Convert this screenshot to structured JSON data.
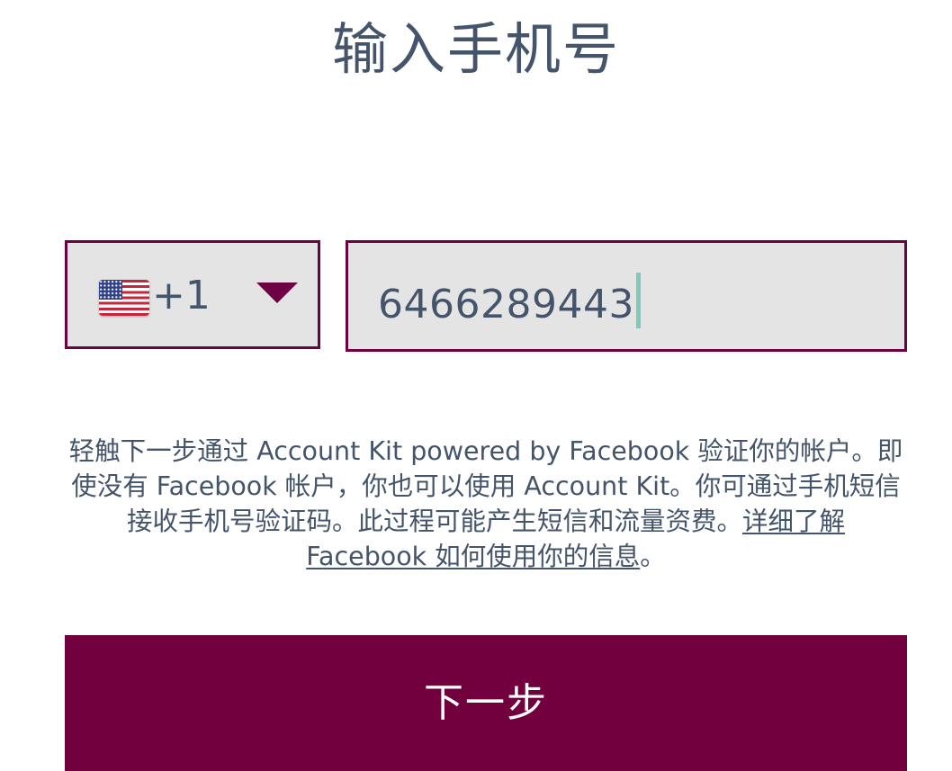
{
  "page": {
    "title": "输入手机号"
  },
  "phone": {
    "country_flag": "us-flag-icon",
    "dial_code": "+1",
    "number": "6466289443"
  },
  "disclaimer": {
    "text": "轻触下一步通过 Account Kit powered by Facebook 验证你的帐户。即使没有 Facebook 帐户，你也可以使用 Account Kit。你可通过手机短信接收手机号验证码。此过程可能产生短信和流量资费。",
    "link_text": "详细了解 Facebook 如何使用你的信息",
    "trailing": "。"
  },
  "actions": {
    "next_label": "下一步"
  },
  "colors": {
    "accent": "#72003f",
    "field_background": "#e4e4e4",
    "text": "#44546a",
    "cursor": "#7ccbb9"
  }
}
